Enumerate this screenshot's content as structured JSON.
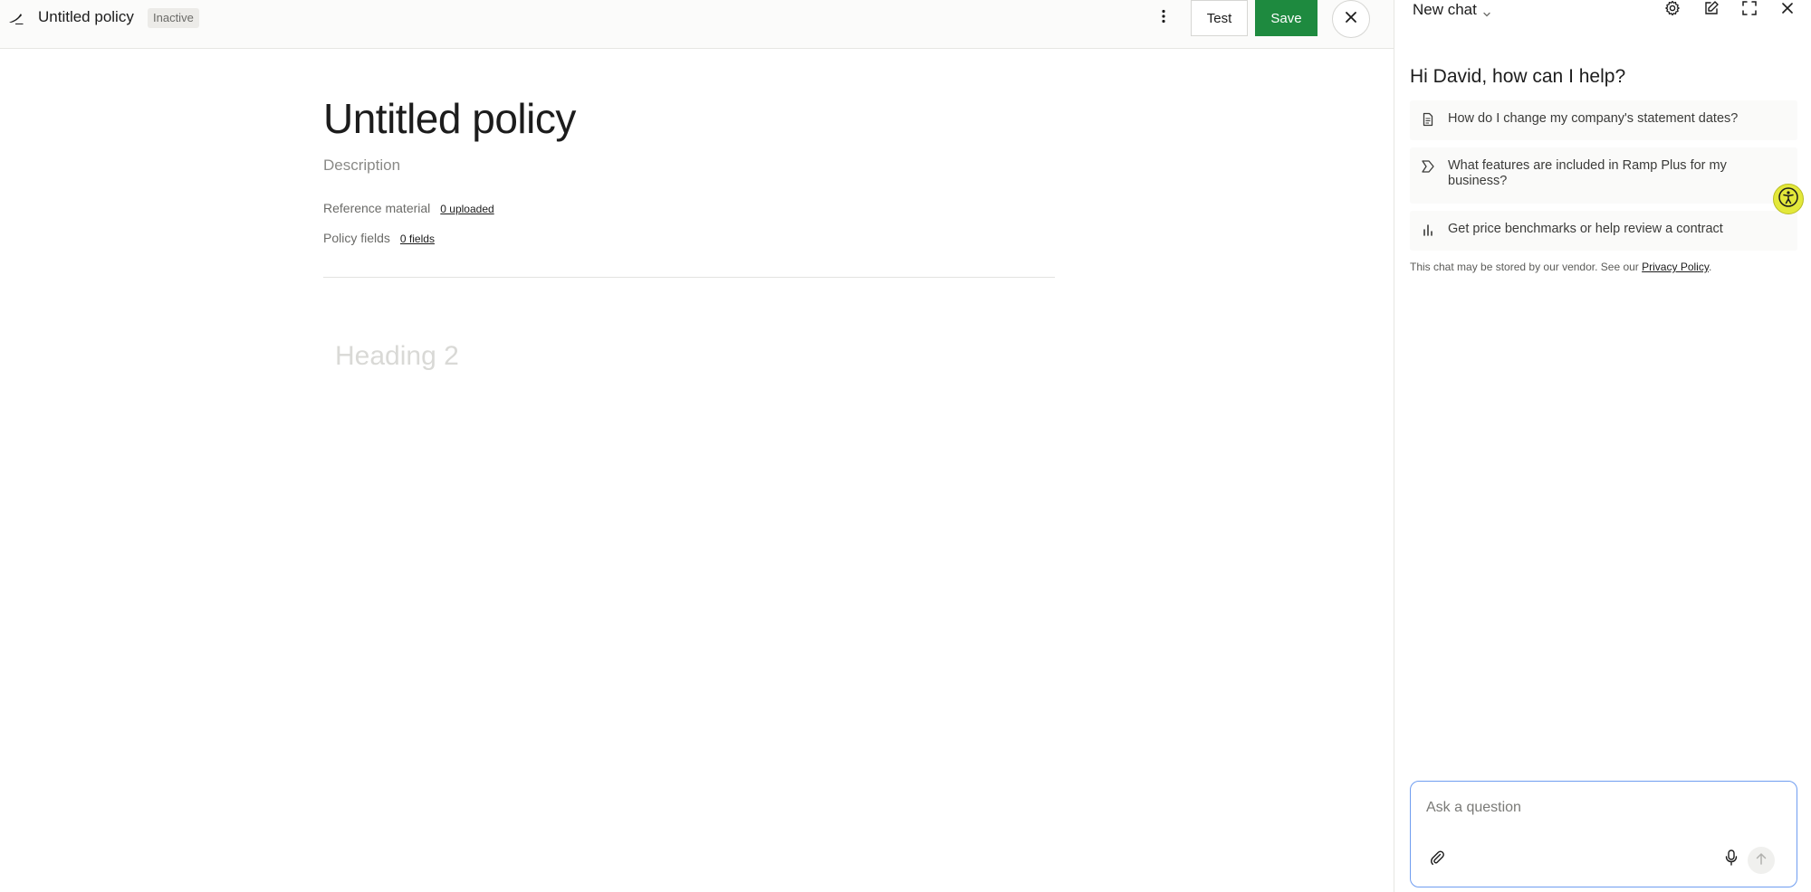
{
  "editor": {
    "doc_title": "Untitled policy",
    "status": "Inactive",
    "test_label": "Test",
    "save_label": "Save",
    "page_title": "Untitled policy",
    "description_placeholder": "Description",
    "reference_material": {
      "label": "Reference material",
      "link": "0 uploaded"
    },
    "policy_fields": {
      "label": "Policy fields",
      "link": "0 fields"
    },
    "heading_placeholder": "Heading 2"
  },
  "chat": {
    "title": "New chat",
    "greeting": "Hi David, how can I help?",
    "suggestions": [
      {
        "icon": "document-icon",
        "text": "How do I change my company's statement dates?"
      },
      {
        "icon": "ramp-plus-icon",
        "text": "What features are included in Ramp Plus for my business?"
      },
      {
        "icon": "bar-chart-icon",
        "text": "Get price benchmarks or help review a contract"
      }
    ],
    "disclaimer": {
      "text": "This chat may be stored by our vendor. See our ",
      "link": "Privacy Policy",
      "suffix": "."
    },
    "composer_placeholder": "Ask a question"
  },
  "colors": {
    "accent_green": "#1e8a3f",
    "composer_border": "#6f9df0",
    "a11y_yellow": "#e3e83a"
  }
}
